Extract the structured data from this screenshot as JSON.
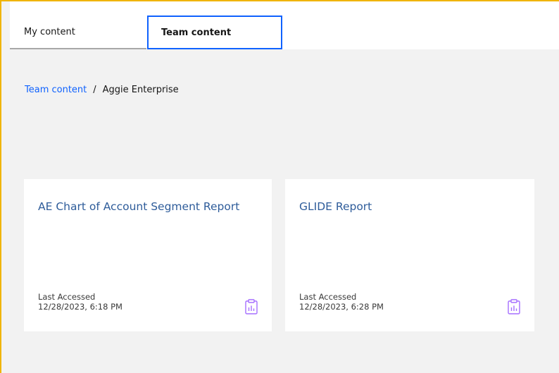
{
  "tabs": {
    "my_content": "My content",
    "team_content": "Team content"
  },
  "breadcrumb": {
    "root": "Team content",
    "separator": "/",
    "current": "Aggie Enterprise"
  },
  "cards": [
    {
      "title": "AE Chart of Account Segment Report",
      "meta_label": "Last Accessed",
      "meta_value": "12/28/2023, 6:18 PM",
      "icon": "report-icon"
    },
    {
      "title": "GLIDE Report",
      "meta_label": "Last Accessed",
      "meta_value": "12/28/2023, 6:28 PM",
      "icon": "report-icon"
    }
  ],
  "colors": {
    "accent": "#0f62fe",
    "link": "#2e5c9a",
    "icon": "#a56eff",
    "frame": "#f0b400"
  }
}
